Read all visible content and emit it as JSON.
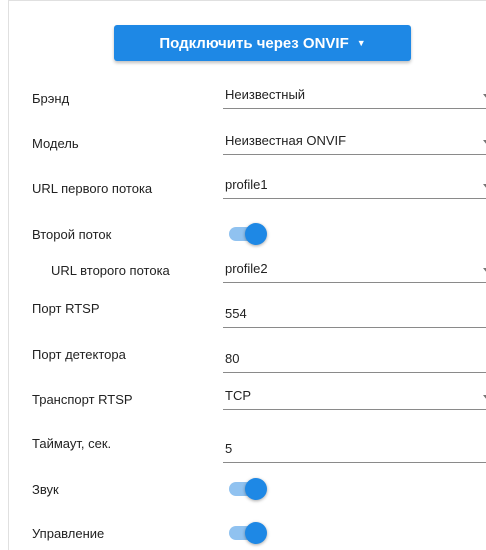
{
  "connect_button": {
    "label": "Подключить через ONVIF",
    "caret_icon": "caret-down-icon"
  },
  "brand": {
    "label": "Брэнд",
    "value": "Неизвестный"
  },
  "model": {
    "label": "Модель",
    "value": "Неизвестная ONVIF"
  },
  "first_stream_url": {
    "label": "URL первого потока",
    "value": "profile1"
  },
  "second_stream": {
    "label": "Второй поток",
    "enabled": true
  },
  "second_stream_url": {
    "label": "URL второго потока",
    "value": "profile2"
  },
  "rtsp_port": {
    "label": "Порт RTSP",
    "value": "554"
  },
  "detector_port": {
    "label": "Порт детектора",
    "value": "80"
  },
  "rtsp_transport": {
    "label": "Транспорт RTSP",
    "value": "TCP"
  },
  "timeout": {
    "label": "Таймаут, сек.",
    "value": "5"
  },
  "sound": {
    "label": "Звук",
    "enabled": true
  },
  "control": {
    "label": "Управление",
    "enabled": true
  },
  "colors": {
    "accent": "#1e88e5",
    "toggle_track": "#90c2f0",
    "underline": "#8a8a8a"
  }
}
